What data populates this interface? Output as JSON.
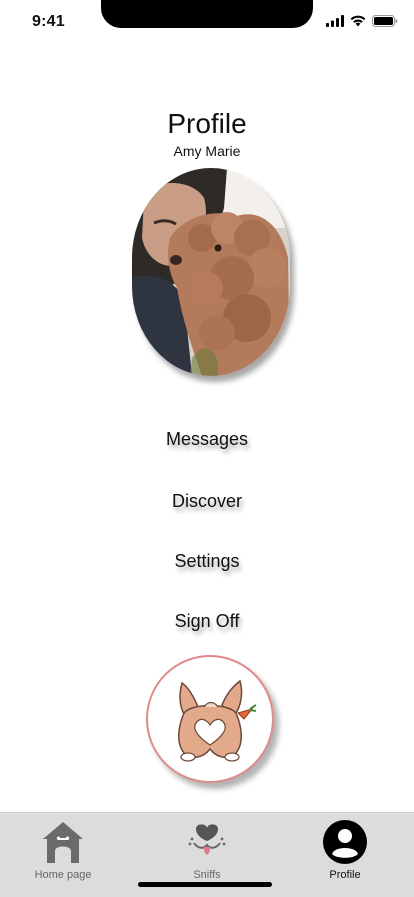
{
  "status": {
    "time": "9:41",
    "icons": [
      "signal-icon",
      "wifi-icon",
      "battery-icon"
    ]
  },
  "header": {
    "title": "Profile",
    "user_name": "Amy Marie"
  },
  "menu": {
    "items": [
      {
        "label": "Messages"
      },
      {
        "label": "Discover"
      },
      {
        "label": "Settings"
      },
      {
        "label": "Sign Off"
      }
    ]
  },
  "tabs": [
    {
      "label": "Home page",
      "icon": "dog-house-icon",
      "active": false
    },
    {
      "label": "Sniffs",
      "icon": "dog-nose-icon",
      "active": false
    },
    {
      "label": "Profile",
      "icon": "profile-icon",
      "active": true
    }
  ],
  "colors": {
    "accent_border": "#e08a8a",
    "tab_bar": "#dcdcdc",
    "dog_fur": "#e2a98a"
  }
}
